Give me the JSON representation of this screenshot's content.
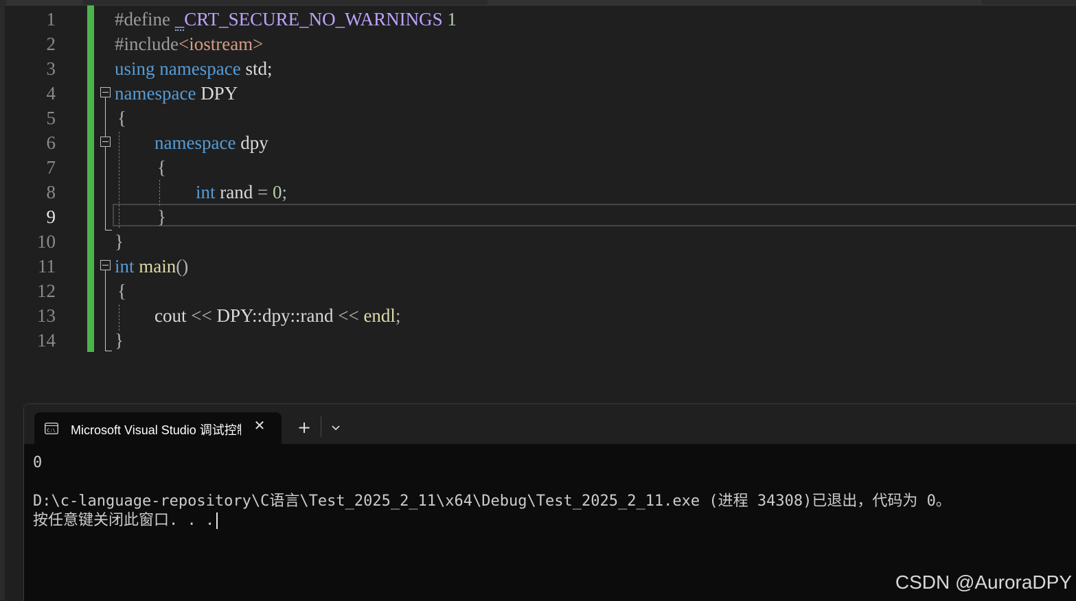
{
  "editor": {
    "line_numbers": [
      "1",
      "2",
      "3",
      "4",
      "5",
      "6",
      "7",
      "8",
      "9",
      "10",
      "11",
      "12",
      "13",
      "14"
    ],
    "active_line": "9",
    "code": {
      "l1_directive": "#define ",
      "l1_macro_squig": "_",
      "l1_macro_rest": "CRT_SECURE_NO_WARNINGS",
      "l1_value": " 1",
      "l2_directive": "#include",
      "l2_header": "<iostream>",
      "l3_kw1": "using",
      "l3_kw2": "namespace",
      "l3_rest": " std;",
      "l4_kw": "namespace",
      "l4_name": " DPY",
      "l5_brace": "{",
      "l6_kw": "namespace",
      "l6_name": " dpy",
      "l7_brace": "{",
      "l8_kw": "int",
      "l8_var": " rand ",
      "l8_op": "=",
      "l8_val": " 0",
      "l8_semi": ";",
      "l9_brace": "}",
      "l10_brace": "}",
      "l11_kw": "int",
      "l11_fn": " main",
      "l11_parens": "()",
      "l12_brace": "{",
      "l13_cout": "cout ",
      "l13_op1": "<<",
      "l13_scope": " DPY::dpy::rand ",
      "l13_op2": "<<",
      "l13_endl": " endl",
      "l13_semi": ";",
      "l14_brace": "}"
    }
  },
  "terminal": {
    "tab_title": "Microsoft Visual Studio 调试控制台",
    "close_glyph": "✕",
    "add_glyph": "+",
    "output_line1": "0",
    "output_line2": "D:\\c-language-repository\\C语言\\Test_2025_2_11\\x64\\Debug\\Test_2025_2_11.exe (进程 34308)已退出，代码为 0。",
    "output_line3": "按任意键关闭此窗口. . ."
  },
  "watermark": "CSDN @AuroraDPY",
  "colors": {
    "keyword": "#569cd6",
    "change_bar": "#4bb54b",
    "terminal_bg": "#0c0c0c"
  }
}
